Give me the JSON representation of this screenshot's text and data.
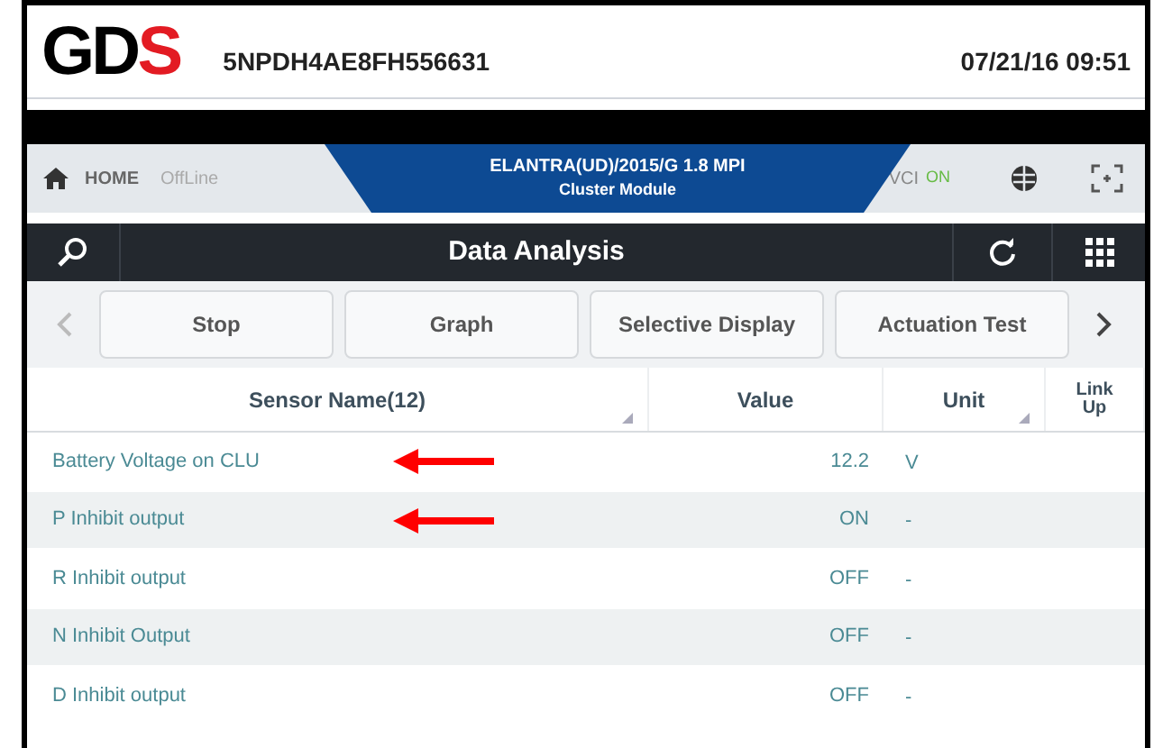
{
  "header": {
    "logo": "GD",
    "logo_accent": "S",
    "vin": "5NPDH4AE8FH556631",
    "datetime": "07/21/16 09:51"
  },
  "nav": {
    "home": "HOME",
    "mode": "OffLine",
    "vehicle": "ELANTRA(UD)/2015/G 1.8 MPI",
    "system": "Cluster Module",
    "vci": "VCI",
    "vci_status": "ON"
  },
  "title": "Data Analysis",
  "buttons": [
    "Stop",
    "Graph",
    "Selective Display",
    "Actuation Test"
  ],
  "table": {
    "columns": [
      "Sensor Name(12)",
      "Value",
      "Unit",
      "Link Up"
    ],
    "rows": [
      {
        "name": "Battery Voltage on CLU",
        "value": "12.2",
        "unit": "V",
        "arrow": true
      },
      {
        "name": "P Inhibit output",
        "value": "ON",
        "unit": "-",
        "arrow": true
      },
      {
        "name": "R Inhibit output",
        "value": "OFF",
        "unit": "-",
        "arrow": false
      },
      {
        "name": "N Inhibit Output",
        "value": "OFF",
        "unit": "-",
        "arrow": false
      },
      {
        "name": "D Inhibit output",
        "value": "OFF",
        "unit": "-",
        "arrow": false
      }
    ]
  }
}
